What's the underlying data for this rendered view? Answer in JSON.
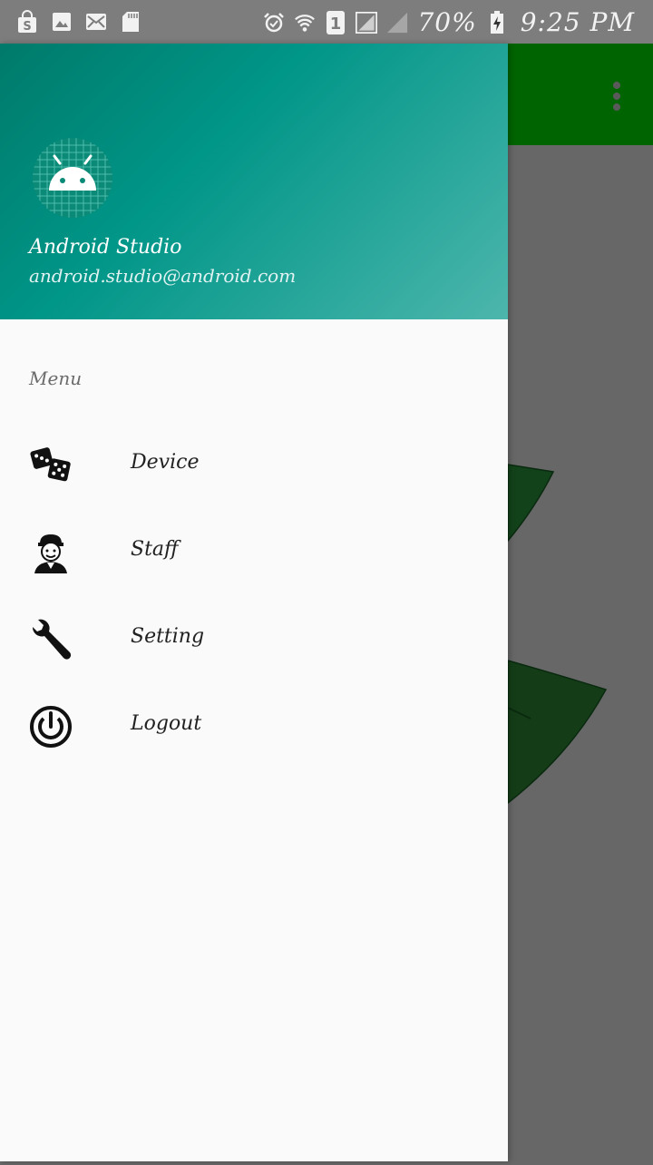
{
  "status_bar": {
    "battery": "70%",
    "time": "9:25 PM",
    "sim_slot": "1",
    "left_icons": [
      "shop-icon",
      "image-icon",
      "mail-icon",
      "sd-card-icon"
    ],
    "right_icons": [
      "alarm-icon",
      "wifi-icon",
      "sim-icon",
      "signal-icon",
      "signal-icon",
      "battery-icon"
    ]
  },
  "drawer": {
    "header": {
      "name": "Android Studio",
      "email": "android.studio@android.com"
    },
    "menu_title": "Menu",
    "items": [
      {
        "label": "Device",
        "icon": "dice-icon"
      },
      {
        "label": "Staff",
        "icon": "staff-icon"
      },
      {
        "label": "Setting",
        "icon": "wrench-icon"
      },
      {
        "label": "Logout",
        "icon": "power-icon"
      }
    ]
  },
  "colors": {
    "toolbar": "#006400",
    "header_start": "#007a6a",
    "header_end": "#4db6ac",
    "scrim": "#676767",
    "drawer_bg": "#fafafa"
  }
}
